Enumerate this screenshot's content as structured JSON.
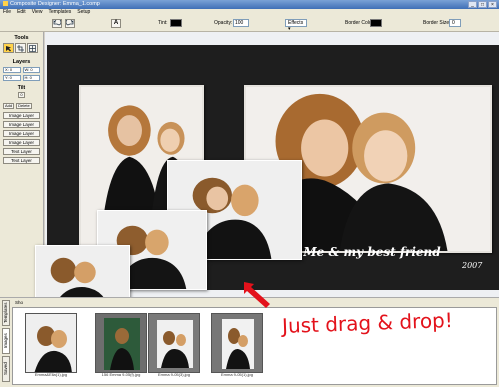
{
  "window": {
    "title": "Composite Designer: Emma_1.comp",
    "buttons": [
      "_",
      "□",
      "×"
    ]
  },
  "menu": [
    "File",
    "Edit",
    "View",
    "Templates",
    "Setup"
  ],
  "toolbar": {
    "text_tool_label": "A",
    "tint_label": "Tint:",
    "tint_color": "#000000",
    "opacity_label": "Opacity:",
    "opacity_value": "100",
    "effects_label": "Effects ▾",
    "border_color_label": "Border Color:",
    "border_color": "#000000",
    "border_size_label": "Border Size:",
    "border_size_value": "0"
  },
  "sidebar": {
    "tools_heading": "Tools",
    "tool_icons": [
      "pointer-icon",
      "crop-icon",
      "grid-icon"
    ],
    "layers_heading": "Layers",
    "fields": [
      "X: 0",
      "W: 0",
      "Y: 0",
      "H: 0"
    ],
    "tilt_heading": "Tilt",
    "tilt_value": "0",
    "add_label": "Add",
    "delete_label": "Delete",
    "layer_buttons": [
      "Image Layer",
      "Image Layer",
      "Image Layer",
      "Image Layer",
      "Text Layer",
      "Text Layer"
    ]
  },
  "canvas": {
    "caption": "Me & my best friend",
    "year": "2007",
    "colors": {
      "board": "#1e1e1e",
      "frame": "#f3f1ef"
    }
  },
  "bottom": {
    "tabs": [
      "Templates",
      "Images",
      "Saved"
    ],
    "active_tab": "Images",
    "path_text": "Sho",
    "thumbs": [
      {
        "label": "Emma&Ella(1).jpg"
      },
      {
        "label": "156 Emma 9-05(f).jpg"
      },
      {
        "label": "Emma 9-05(3).jpg"
      },
      {
        "label": "Emma 9-05(1).jpg"
      }
    ]
  },
  "annotation": {
    "drag_text": "Just drag & drop!",
    "color": "#e3121b"
  }
}
